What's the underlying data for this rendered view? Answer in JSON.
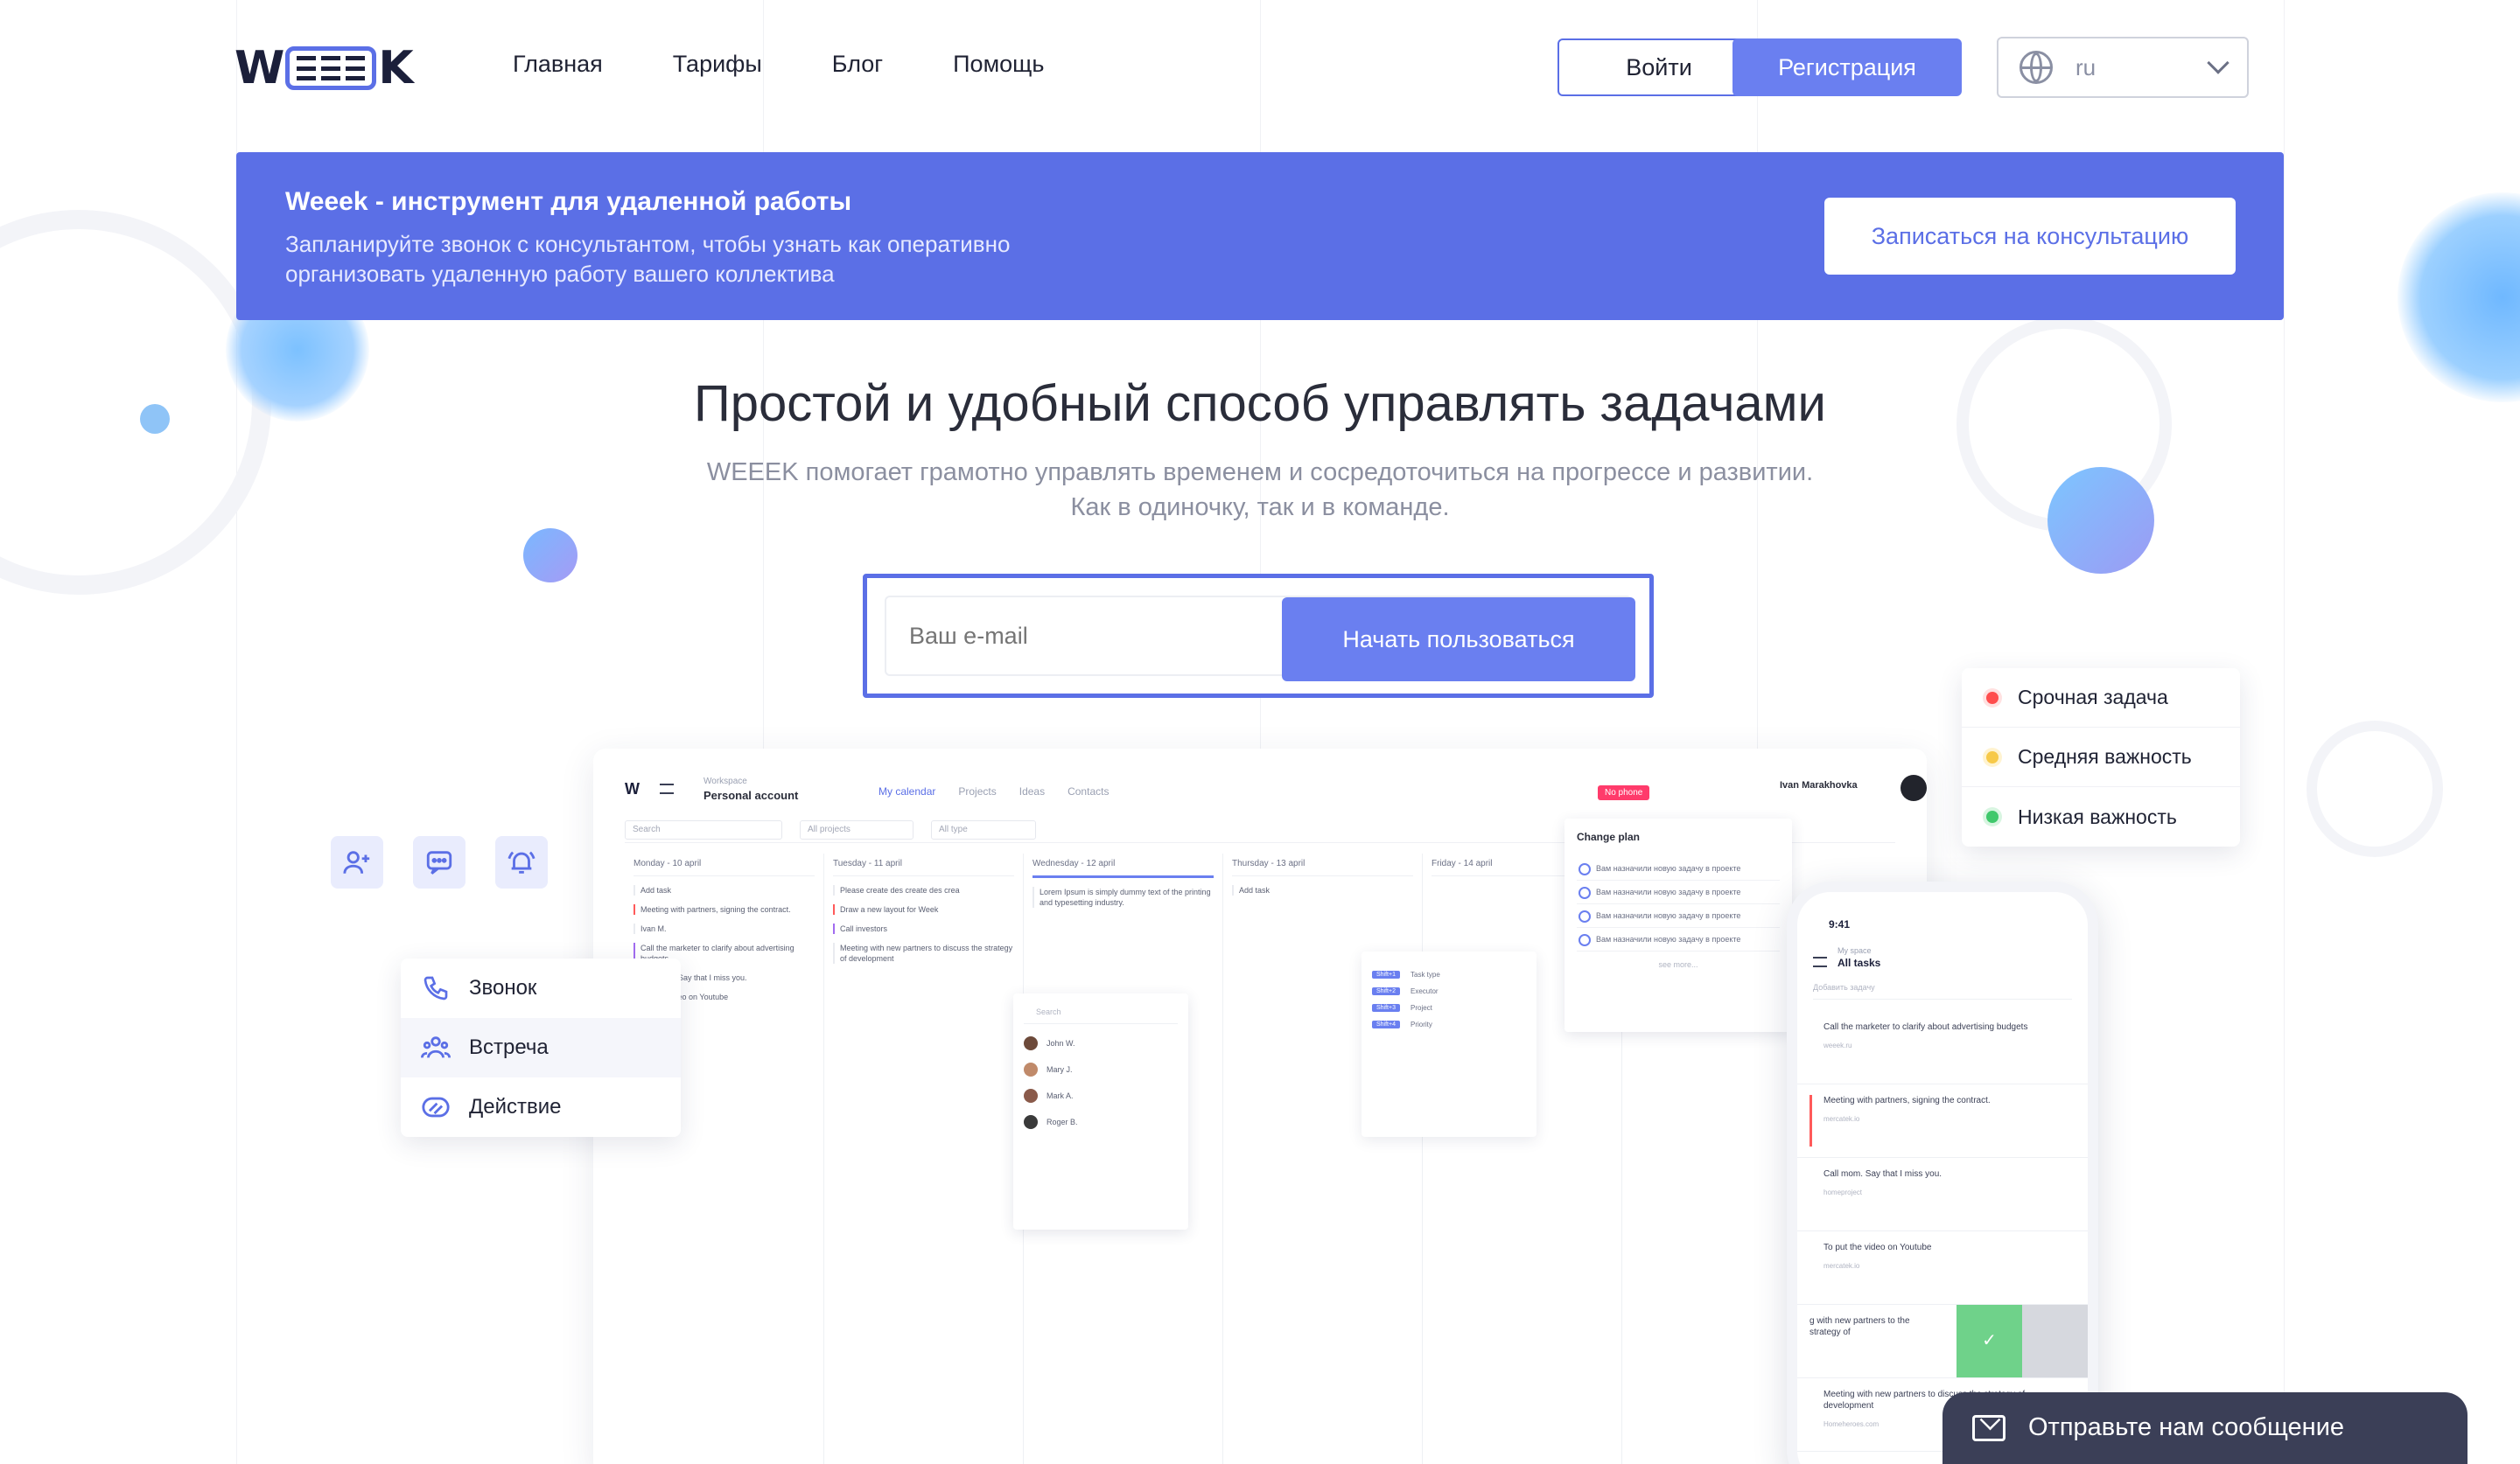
{
  "colors": {
    "accent": "#5b6fe6",
    "button": "#6a7ff0",
    "urgent": "#ff4d4d",
    "medium": "#f7c948",
    "low": "#3fc86b",
    "chat_bg": "#3b3f57"
  },
  "header": {
    "logo": "WEEEK",
    "nav": [
      "Главная",
      "Тарифы",
      "Блог",
      "Помощь"
    ],
    "login": "Войти",
    "register": "Регистрация",
    "language": "ru"
  },
  "banner": {
    "title": "Weeek - инструмент для удаленной работы",
    "text": "Запланируйте звонок с консультантом, чтобы узнать как оперативно организовать удаленную работу вашего коллектива",
    "button": "Записаться на консультацию"
  },
  "hero": {
    "title": "Простой и удобный способ управлять задачами",
    "subtitle_line1": "WEEEK помогает грамотно управлять временем и сосредоточиться на прогрессе и развитии.",
    "subtitle_line2": "Как в одиночку, так и в команде.",
    "email_placeholder": "Ваш e-mail",
    "start_button": "Начать пользоваться"
  },
  "app_preview": {
    "logo": "W",
    "workspace_label": "Workspace",
    "workspace": "Personal account",
    "tabs": [
      "My calendar",
      "Projects",
      "Ideas",
      "Contacts"
    ],
    "no_phone": "No phone",
    "user": "Ivan Marakhovka",
    "filters": [
      "Search",
      "All projects",
      "All type"
    ],
    "columns": [
      {
        "day": "Monday - 10 april",
        "tasks": [
          "Add task",
          "Meeting with partners, signing the contract.",
          "Ivan M.",
          "Call the marketer to clarify about advertising budgets",
          "Call mom. Say that I miss you.",
          "Put the video on Youtube"
        ]
      },
      {
        "day": "Tuesday - 11 april",
        "tasks": [
          "Please create des create des crea",
          "Draw a new layout for Week",
          "Call investors",
          "Meeting with new partners to discuss the strategy of development"
        ]
      },
      {
        "day": "Wednesday - 12 april",
        "tasks": [
          "Lorem Ipsum is simply dummy text of the printing and typesetting industry."
        ]
      },
      {
        "day": "Thursday - 13 april",
        "tasks": [
          "Add task"
        ]
      },
      {
        "day": "Friday - 14 april",
        "tasks": []
      }
    ],
    "people": [
      "Search",
      "John W.",
      "Mary J.",
      "Mark A.",
      "Roger B."
    ],
    "props": [
      "Task type",
      "Executor",
      "Project",
      "Priority"
    ],
    "change_plan": {
      "title": "Change plan",
      "items": [
        "Вам назначили новую задачу в проекте",
        "Вам назначили новую задачу в проекте",
        "Вам назначили новую задачу в проекте",
        "Вам назначили новую задачу в проекте"
      ],
      "more": "see more..."
    }
  },
  "phone": {
    "time": "9:41",
    "space": "My space",
    "title": "All tasks",
    "search": "Добавить задачу",
    "tasks": [
      {
        "text": "Call the marketer to clarify about advertising budgets",
        "sub": "weeek.ru"
      },
      {
        "text": "Meeting with partners, signing the contract.",
        "sub": "mercatek.io"
      },
      {
        "text": "Call mom. Say that I miss you.",
        "sub": "homeproject"
      },
      {
        "text": "To put the video on Youtube",
        "sub": "mercatek.io"
      },
      {
        "text": "g with new partners to the strategy of",
        "sub": ""
      },
      {
        "text": "Meeting with new partners to discuss the strategy of development",
        "sub": "Homeheroes.com"
      }
    ]
  },
  "actions": [
    "Звонок",
    "Встреча",
    "Действие"
  ],
  "priorities": [
    "Срочная задача",
    "Средняя важность",
    "Низкая важность"
  ],
  "chat": {
    "label": "Отправьте нам сообщение"
  }
}
